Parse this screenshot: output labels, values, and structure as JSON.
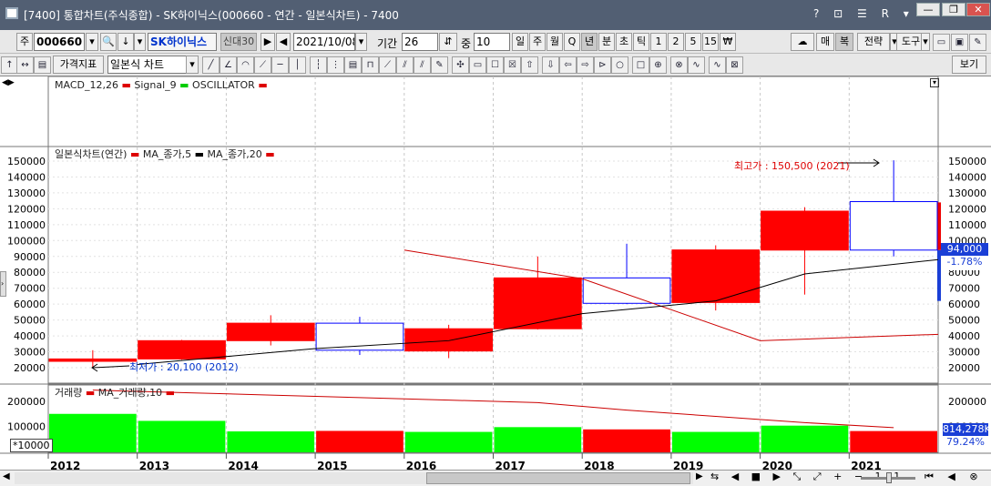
{
  "window": {
    "title": "[7400] 통합차트(주식종합) - SK하이닉스(000660 - 연간 - 일본식차트) - 7400",
    "sys_icons": "? ⊡ ☰ R ▾",
    "minimize": "—",
    "restore": "❐",
    "close": "✕"
  },
  "toolbar1": {
    "market": "주",
    "code": "000660",
    "stock_name": "SK하이닉스",
    "credit_badge": "신대30",
    "date": "2021/10/08",
    "period_label": "기간",
    "period_value": "26",
    "count_label": "중",
    "count_value": "10",
    "timeframes": [
      "일",
      "주",
      "월",
      "Q",
      "년",
      "분",
      "초",
      "틱",
      "1",
      "2",
      "5",
      "15",
      "₩"
    ],
    "right_buttons": [
      "매",
      "복",
      "전략",
      "도구"
    ]
  },
  "toolbar2": {
    "indicator_button": "가격지표",
    "chart_type": "일본식 차트",
    "view_button": "보기"
  },
  "panels": {
    "macd_legend": [
      "MACD_12,26",
      "Signal_9",
      "OSCILLATOR"
    ],
    "price_legend": [
      "일본식차트(연간)",
      "MA_종가,5",
      "MA_종가,20"
    ],
    "volume_legend": [
      "거래량",
      "MA_거래량,10"
    ],
    "volume_unit": "*10000"
  },
  "annotations": {
    "high": "최고가 : 150,500 (2021)",
    "low": "최저가 : 20,100 (2012)"
  },
  "price_axis_ticks": [
    "150000",
    "140000",
    "130000",
    "120000",
    "110000",
    "100000",
    "90000",
    "80000",
    "70000",
    "60000",
    "50000",
    "40000",
    "30000",
    "20000"
  ],
  "volume_axis_ticks": [
    "200000",
    "100000"
  ],
  "current_price": {
    "value": "94,000",
    "change": "-1.78%"
  },
  "current_volume": {
    "value": "814,278K",
    "ratio": "79.24%"
  },
  "colors": {
    "up": "#ff0000",
    "down": "#0000ff",
    "volume": "#00ff00",
    "ma5": "#000000",
    "ma20": "#cc0000"
  },
  "chart_data": {
    "type": "candlestick",
    "title": "일본식차트(연간)",
    "x": [
      "2012",
      "2013",
      "2014",
      "2015",
      "2016",
      "2017",
      "2018",
      "2019",
      "2020",
      "2021"
    ],
    "open": [
      24000,
      25500,
      37000,
      48000,
      30500,
      44500,
      76500,
      61000,
      94000,
      124500
    ],
    "high": [
      31000,
      37500,
      53000,
      52000,
      47000,
      90000,
      98000,
      97000,
      121000,
      150500
    ],
    "low": [
      20100,
      25000,
      34000,
      28000,
      26000,
      44000,
      60000,
      56000,
      66000,
      90000
    ],
    "close": [
      25500,
      37000,
      48000,
      31000,
      44500,
      76500,
      60500,
      94100,
      118500,
      94000
    ],
    "ma5": [
      null,
      null,
      null,
      null,
      null,
      54000,
      62000,
      null,
      79000,
      88000
    ],
    "ma20_visible": [
      null,
      null,
      null,
      null,
      94000,
      null,
      null,
      37000,
      null,
      41000
    ],
    "volume": [
      150000,
      122000,
      80000,
      82000,
      78000,
      97000,
      88000,
      78000,
      103000,
      81428
    ],
    "volume_ma10": [
      245000,
      235000,
      225000,
      215000,
      205000,
      195000,
      165000,
      140000,
      115000,
      95000
    ],
    "ylim": [
      15000,
      160000
    ],
    "volume_ylim": [
      0,
      240000
    ]
  }
}
